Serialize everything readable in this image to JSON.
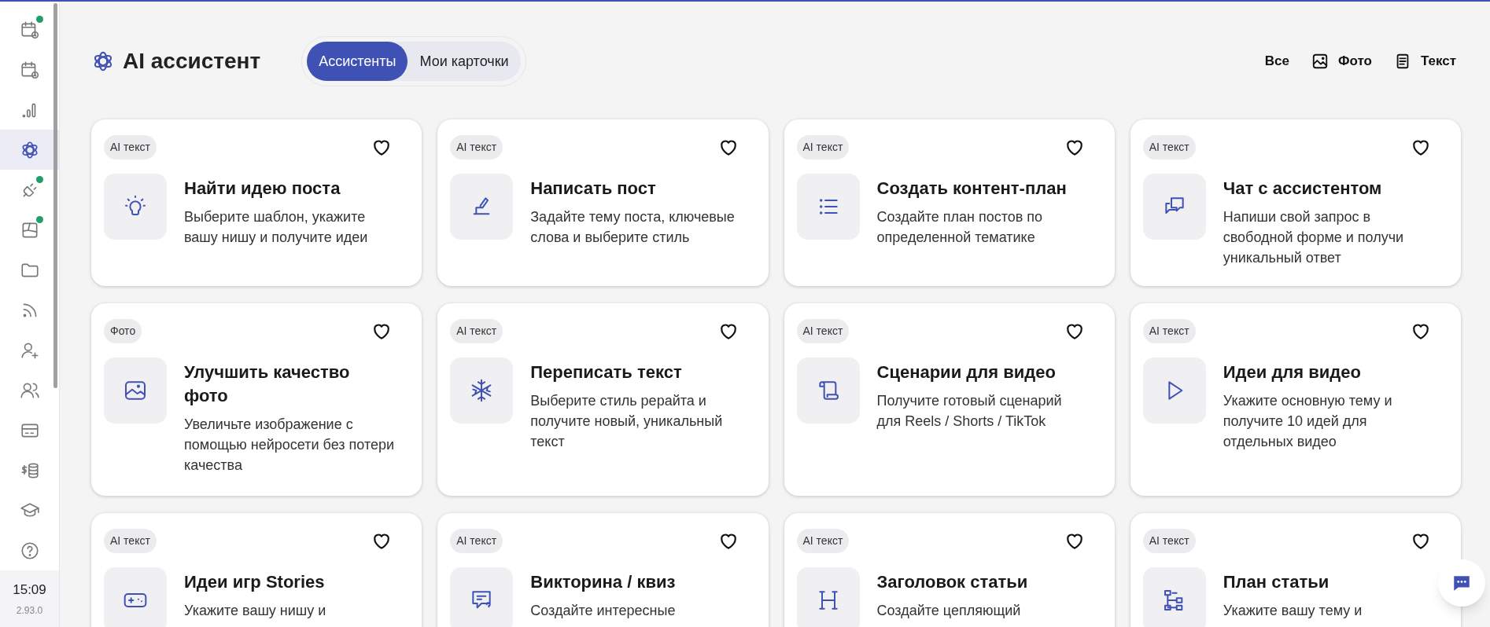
{
  "sidebar": {
    "items": [
      {
        "selected": false,
        "notification": true
      },
      {
        "selected": false,
        "notification": false
      },
      {
        "selected": false,
        "notification": false
      },
      {
        "selected": true,
        "notification": false
      },
      {
        "selected": false,
        "notification": true
      },
      {
        "selected": false,
        "notification": true
      },
      {
        "selected": false,
        "notification": false
      },
      {
        "selected": false,
        "notification": false
      },
      {
        "selected": false,
        "notification": false
      },
      {
        "selected": false,
        "notification": false
      },
      {
        "selected": false,
        "notification": false
      },
      {
        "selected": false,
        "notification": false
      },
      {
        "selected": false,
        "notification": false
      },
      {
        "selected": false,
        "notification": false
      }
    ],
    "time": "15:09",
    "version": "2.93.0"
  },
  "header": {
    "title": "AI ассистент",
    "tabs": [
      {
        "label": "Ассистенты",
        "selected": true
      },
      {
        "label": "Мои карточки",
        "selected": false
      }
    ],
    "filters": [
      {
        "label": "Все"
      },
      {
        "label": "Фото"
      },
      {
        "label": "Текст"
      }
    ]
  },
  "cards": [
    {
      "tag": "AI текст",
      "title": "Найти идею поста",
      "description": "Выберите шаблон, укажите вашу нишу и получите идеи",
      "favorite": false
    },
    {
      "tag": "AI текст",
      "title": "Написать пост",
      "description": "Задайте тему поста, ключевые слова и выберите стиль",
      "favorite": false
    },
    {
      "tag": "AI текст",
      "title": "Создать контент-план",
      "description": "Создайте план постов по определенной тематике",
      "favorite": false
    },
    {
      "tag": "AI текст",
      "title": "Чат с ассистентом",
      "description": "Напиши свой запрос в свободной форме и получи уникальный ответ",
      "favorite": false
    },
    {
      "tag": "Фото",
      "title": "Улучшить качество фото",
      "description": "Увеличьте изображение с помощью нейросети без потери качества",
      "favorite": false
    },
    {
      "tag": "AI текст",
      "title": "Переписать текст",
      "description": "Выберите стиль рерайта и получите новый, уникальный текст",
      "favorite": false
    },
    {
      "tag": "AI текст",
      "title": "Сценарии для видео",
      "description": "Получите готовый сценарий для Reels / Shorts / TikTok",
      "favorite": false
    },
    {
      "tag": "AI текст",
      "title": "Идеи для видео",
      "description": "Укажите основную тему и получите 10 идей для отдельных видео",
      "favorite": false
    },
    {
      "tag": "AI текст",
      "title": "Идеи игр Stories",
      "description": "Укажите вашу нишу и",
      "favorite": false
    },
    {
      "tag": "AI текст",
      "title": "Викторина / квиз",
      "description": "Создайте интересные",
      "favorite": false
    },
    {
      "tag": "AI текст",
      "title": "Заголовок статьи",
      "description": "Создайте цепляющий",
      "favorite": false
    },
    {
      "tag": "AI текст",
      "title": "План статьи",
      "description": "Укажите вашу тему и",
      "favorite": false
    }
  ]
}
